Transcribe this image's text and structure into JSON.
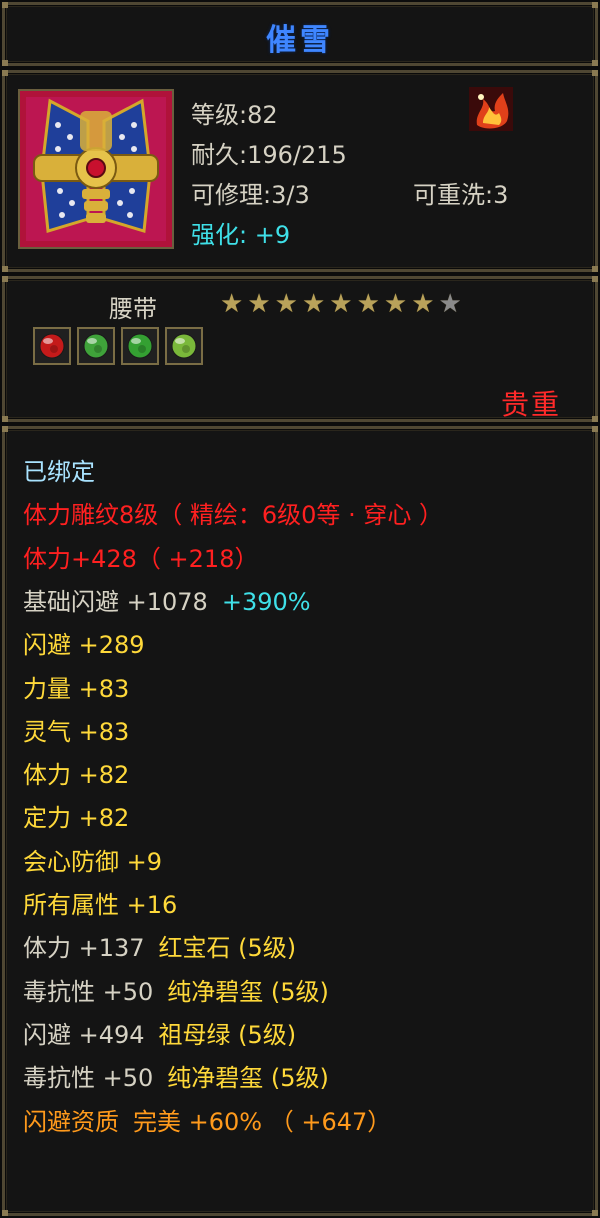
{
  "item_name": "催雪",
  "stats": {
    "level": "等级:82",
    "durability": "耐久:196/215",
    "repair": "可修理:3/3",
    "rewash": "可重洗:3",
    "enhance_label": "强化:",
    "enhance_value": "+9"
  },
  "item_type": "腰带",
  "stars": {
    "total": 9,
    "filled": 8
  },
  "gems": [
    {
      "name": "ruby-gem",
      "color": "#c41a1a"
    },
    {
      "name": "jade-gem",
      "color": "#3fa33a"
    },
    {
      "name": "emerald-gem",
      "color": "#34a032"
    },
    {
      "name": "jade-gem",
      "color": "#7ab83a"
    }
  ],
  "rarity": "贵重",
  "colors": {
    "white": "#d6d2c4",
    "light_blue": "#a9e3ff",
    "red": "#ff2020",
    "yellow": "#ffd93a",
    "cyan": "#3fe0e8",
    "orange": "#ff9a1c"
  },
  "lines": [
    {
      "color": "#a9e3ff",
      "a": "已绑定"
    },
    {
      "color": "#ff2020",
      "a": "体力雕纹8级（ 精绘：6级0等 · 穿心 ）"
    },
    {
      "color": "#ff2020",
      "a": "体力+428（ +218）"
    },
    {
      "color": "#d6d2c4",
      "a": "基础闪避 +1078",
      "b": "+390%",
      "b_color": "#3fe0e8"
    },
    {
      "color": "#ffd93a",
      "a": "闪避 +289"
    },
    {
      "color": "#ffd93a",
      "a": "力量 +83"
    },
    {
      "color": "#ffd93a",
      "a": "灵气 +83"
    },
    {
      "color": "#ffd93a",
      "a": "体力 +82"
    },
    {
      "color": "#ffd93a",
      "a": "定力 +82"
    },
    {
      "color": "#ffd93a",
      "a": "会心防御 +9"
    },
    {
      "color": "#ffd93a",
      "a": "所有属性 +16"
    },
    {
      "color": "#d6d2c4",
      "a": "体力 +137",
      "b": "红宝石 (5级)",
      "b_color": "#ffd93a"
    },
    {
      "color": "#d6d2c4",
      "a": "毒抗性 +50",
      "b": "纯净碧玺 (5级)",
      "b_color": "#ffd93a"
    },
    {
      "color": "#d6d2c4",
      "a": "闪避 +494",
      "b": "祖母绿 (5级)",
      "b_color": "#ffd93a"
    },
    {
      "color": "#d6d2c4",
      "a": "毒抗性 +50",
      "b": "纯净碧玺 (5级)",
      "b_color": "#ffd93a"
    },
    {
      "color": "#ff9a1c",
      "a": "闪避资质",
      "b": "完美 +60% （ +647）",
      "b_color": "#ff9a1c"
    }
  ]
}
